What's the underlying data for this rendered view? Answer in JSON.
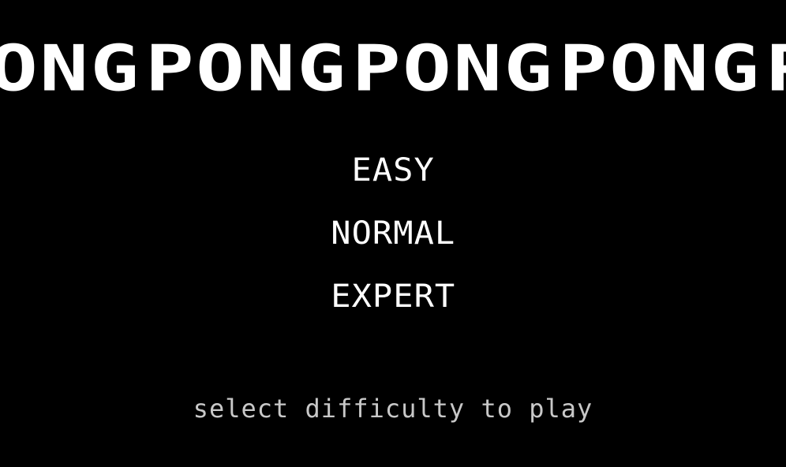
{
  "title": {
    "words": [
      "PONG",
      "PONG",
      "PONG",
      "PONG",
      "PONG"
    ]
  },
  "menu": {
    "items": [
      {
        "label": "EASY"
      },
      {
        "label": "NORMAL"
      },
      {
        "label": "EXPERT"
      }
    ]
  },
  "hint": "select difficulty to play",
  "colors": {
    "background": "#000000",
    "text": "#ffffff",
    "hint": "#c8c8c8"
  }
}
